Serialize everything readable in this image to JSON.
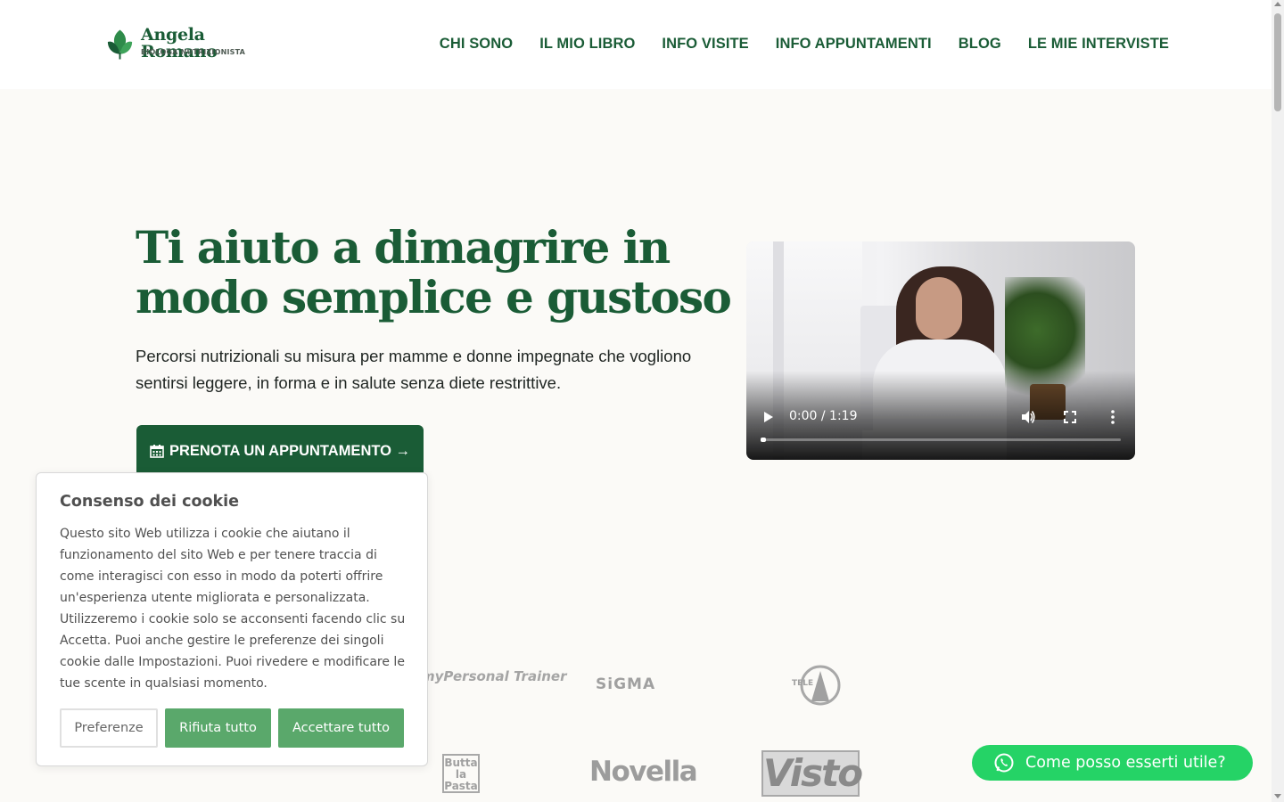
{
  "header": {
    "logo": {
      "name": "Angela Romano",
      "subtitle": "BIOLOGA NUTRIZIONISTA"
    },
    "nav": [
      "CHI SONO",
      "IL MIO LIBRO",
      "INFO VISITE",
      "INFO APPUNTAMENTI",
      "BLOG",
      "LE MIE INTERVISTE"
    ]
  },
  "hero": {
    "title_line1": "Ti aiuto a dimagrire in",
    "title_line2": "modo semplice e gustoso",
    "subtitle": "Percorsi nutrizionali su misura per mamme e donne impegnate che vogliono sentirsi leggere, in forma e in salute senza diete restrittive.",
    "cta_label": "PRENOTA UN APPUNTAMENTO →",
    "cta_icon": "calendar-icon"
  },
  "video": {
    "time": "0:00 / 1:19",
    "progress": 0
  },
  "press": {
    "mypersonal": "myPersonal Trainer",
    "sigma": "SiGMA",
    "telea": "TELE A",
    "butta": "Butta la Pasta",
    "novella": "Novella",
    "visto": "Visto"
  },
  "cookie": {
    "title": "Consenso dei cookie",
    "body": "Questo sito Web utilizza i cookie che aiutano il funzionamento del sito Web e per tenere traccia di come interagisci con esso in modo da poterti offrire un'esperienza utente migliorata e personalizzata. Utilizzeremo i cookie solo se acconsenti facendo clic su Accetta. Puoi anche gestire le preferenze dei singoli cookie dalle Impostazioni. Puoi rivedere e modificare le tue scente in qualsiasi momento.",
    "preferences": "Preferenze",
    "reject": "Rifiuta tutto",
    "accept": "Accettare tutto"
  },
  "whatsapp": {
    "label": "Come posso esserti utile?",
    "icon": "whatsapp-icon"
  },
  "colors": {
    "brand_green": "#1a5c36",
    "cookie_button": "#5aa86b",
    "whatsapp": "#25d366",
    "background": "#fbfaf7"
  }
}
